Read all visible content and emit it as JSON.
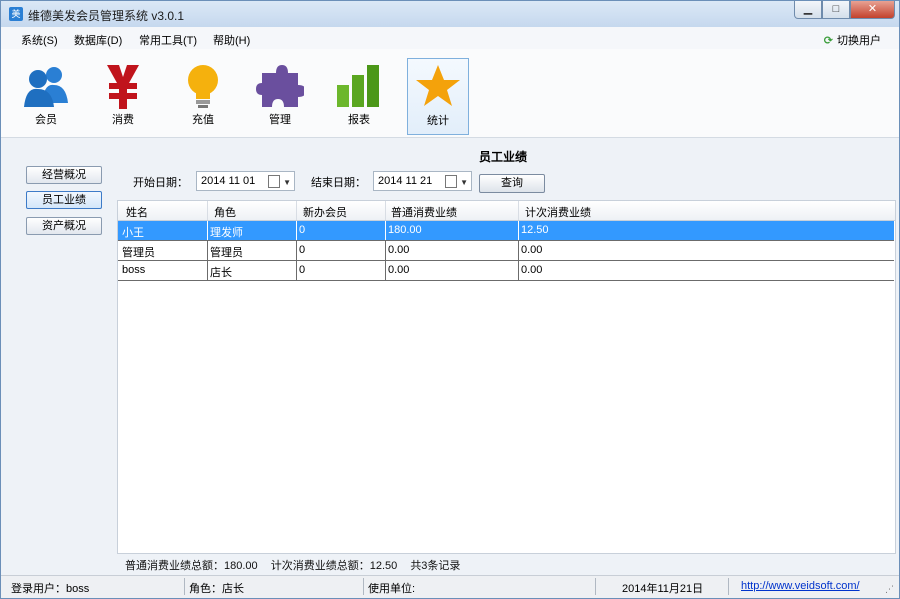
{
  "window": {
    "title": "维德美发会员管理系统 v3.0.1"
  },
  "menu": {
    "items": [
      "系统(S)",
      "数据库(D)",
      "常用工具(T)",
      "帮助(H)"
    ],
    "switch_user": "切换用户"
  },
  "toolbar": {
    "tools": [
      {
        "label": "会员",
        "icon": "members-icon"
      },
      {
        "label": "消费",
        "icon": "yen-icon"
      },
      {
        "label": "充值",
        "icon": "lightbulb-icon"
      },
      {
        "label": "管理",
        "icon": "puzzle-icon"
      },
      {
        "label": "报表",
        "icon": "bar-chart-icon"
      },
      {
        "label": "统计",
        "icon": "star-icon"
      }
    ],
    "active": "统计"
  },
  "sidebar": {
    "items": [
      "经营概况",
      "员工业绩",
      "资产概况"
    ],
    "active": "员工业绩"
  },
  "report": {
    "title": "员工业绩",
    "start_label": "开始日期：",
    "start_value": "2014 11 01",
    "end_label": "结束日期：",
    "end_value": "2014 11 21",
    "query_label": "查询"
  },
  "table": {
    "columns": [
      "姓名",
      "角色",
      "新办会员",
      "普通消费业绩",
      "计次消费业绩"
    ],
    "rows": [
      [
        "小王",
        "理发师",
        "0",
        "180.00",
        "12.50"
      ],
      [
        "管理员",
        "管理员",
        "0",
        "0.00",
        "0.00"
      ],
      [
        "boss",
        "店长",
        "0",
        "0.00",
        "0.00"
      ]
    ],
    "selected_row": 0
  },
  "summary": {
    "normal_total": "普通消费业绩总额：180.00",
    "count_total": "计次消费业绩总额：12.50",
    "records": "共3条记录"
  },
  "status": {
    "user": "登录用户：boss",
    "role": "角色：店长",
    "unit": "使用单位:",
    "date": "2014年11月21日",
    "link": "http://www.veidsoft.com/"
  },
  "colors": {
    "selection": "#3399ff",
    "accent": "#2a7fd4"
  }
}
